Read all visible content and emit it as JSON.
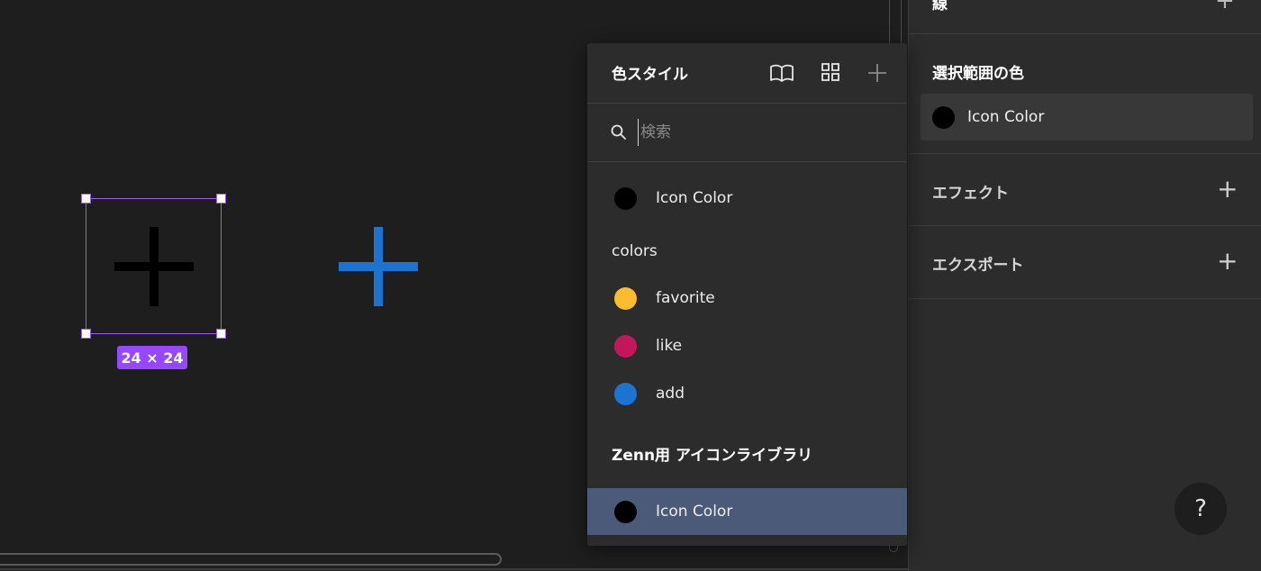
{
  "canvas": {
    "size_badge": "24 × 24"
  },
  "popover": {
    "title": "色スタイル",
    "icons": [
      "library-icon",
      "grid-view-icon",
      "add-style-icon"
    ],
    "search": {
      "placeholder": "検索",
      "value": ""
    },
    "local_style": {
      "name": "Icon Color",
      "color": "#000000"
    },
    "groups": [
      {
        "label": "colors",
        "items": [
          {
            "name": "favorite",
            "color": "#fbbd2e"
          },
          {
            "name": "like",
            "color": "#c2185b"
          },
          {
            "name": "add",
            "color": "#1b74d1"
          }
        ]
      },
      {
        "label": "Zenn用 アイコンライブラリ",
        "items": [
          {
            "name": "Icon Color",
            "color": "#000000",
            "selected": true
          }
        ]
      }
    ]
  },
  "properties": {
    "top_label": "線",
    "selection_colors": {
      "heading": "選択範囲の色",
      "items": [
        {
          "name": "Icon Color",
          "color": "#000000"
        }
      ]
    },
    "effects_label": "エフェクト",
    "export_label": "エクスポート",
    "help_label": "?"
  },
  "colors": {
    "selection_accent": "#9747ff",
    "blue_icon": "#1b74d1",
    "active_row": "#4b5a78"
  }
}
